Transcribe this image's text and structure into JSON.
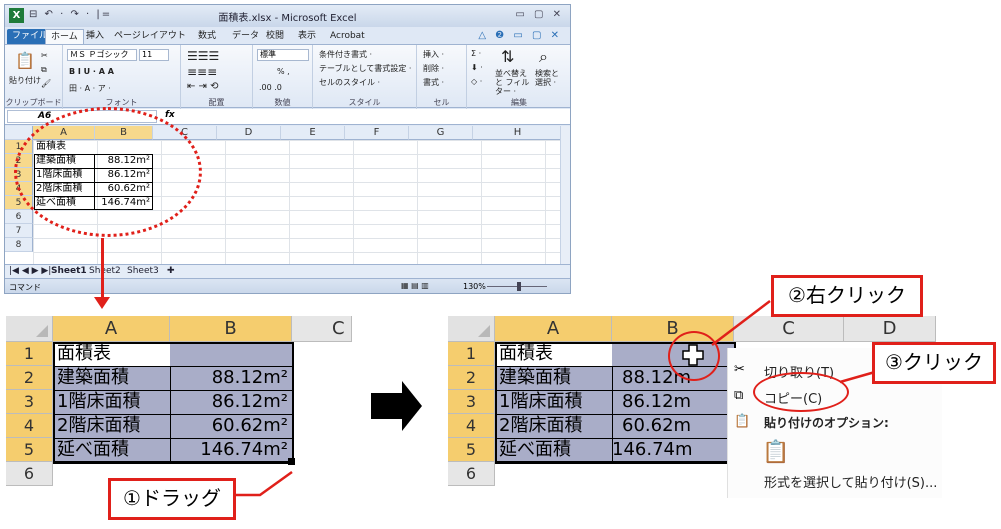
{
  "excel": {
    "title": "面積表.xlsx - Microsoft Excel",
    "logo": "X",
    "quick_access": "⊟ ↶ · ↷ · |=",
    "window_controls": "▭ ▢ ✕",
    "tabs": [
      "ファイル",
      "ホーム",
      "挿入",
      "ページレイアウト",
      "数式",
      "データ",
      "校閲",
      "表示",
      "Acrobat"
    ],
    "tab_right_icons": "△ ❷ ▭ ▢ ✕",
    "ribbon": {
      "paste": "貼り付け",
      "clipboard_label": "クリップボード",
      "font_name": "ＭＳ Ｐゴシック",
      "font_size": "11",
      "font_row2": "B I U · A A",
      "font_row3": "田 · A · ア ·",
      "font_label": "フォント",
      "align_label": "配置",
      "number_format": "標準",
      "number_row2": "% ,",
      "number_row3": ".00 .0",
      "number_label": "数値",
      "style_conditional": "条件付き書式 ·",
      "style_table": "テーブルとして書式設定 ·",
      "style_cell": "セルのスタイル ·",
      "style_label": "スタイル",
      "cell_insert": "挿入 ·",
      "cell_delete": "削除 ·",
      "cell_format": "書式 ·",
      "cell_label": "セル",
      "edit_sort": "並べ替えと フィルター ·",
      "edit_find": "検索と 選択 ·",
      "edit_label": "編集"
    },
    "namebox": "A6",
    "fx": "fx",
    "columns": [
      "A",
      "B",
      "C",
      "D",
      "E",
      "F",
      "G",
      "H"
    ],
    "rows": [
      "1",
      "2",
      "3",
      "4",
      "5",
      "6",
      "7",
      "8"
    ],
    "sheets": [
      "Sheet1",
      "Sheet2",
      "Sheet3"
    ],
    "sheet_nav": "|◀ ◀ ▶ ▶|",
    "status": "コマンド",
    "zoom": "130%"
  },
  "table": {
    "title": "面積表",
    "rows": [
      {
        "label": "建築面積",
        "value": "88.12m²"
      },
      {
        "label": "1階床面積",
        "value": "86.12m²"
      },
      {
        "label": "2階床面積",
        "value": "60.62m²"
      },
      {
        "label": "延べ面積",
        "value": "146.74m²"
      }
    ]
  },
  "zoom_left": {
    "columns": [
      "A",
      "B",
      "C"
    ],
    "rows": [
      "1",
      "2",
      "3",
      "4",
      "5",
      "6"
    ]
  },
  "zoom_right": {
    "columns": [
      "A",
      "B",
      "C",
      "D"
    ],
    "rows": [
      "1",
      "2",
      "3",
      "4",
      "5",
      "6"
    ],
    "value_clipped": [
      "88.12m",
      "86.12m",
      "60.62m",
      "146.74m"
    ]
  },
  "context_menu": {
    "cut": "切り取り(T)",
    "copy": "コピー(C)",
    "paste_options": "貼り付けのオプション:",
    "paste_special": "形式を選択して貼り付け(S)..."
  },
  "callouts": {
    "drag": "①ドラッグ",
    "right_click": "②右クリック",
    "click": "③クリック"
  },
  "colors": {
    "annotation_red": "#e0201a",
    "selection": "#a9adc8",
    "header_selected": "#f5cd6e"
  }
}
